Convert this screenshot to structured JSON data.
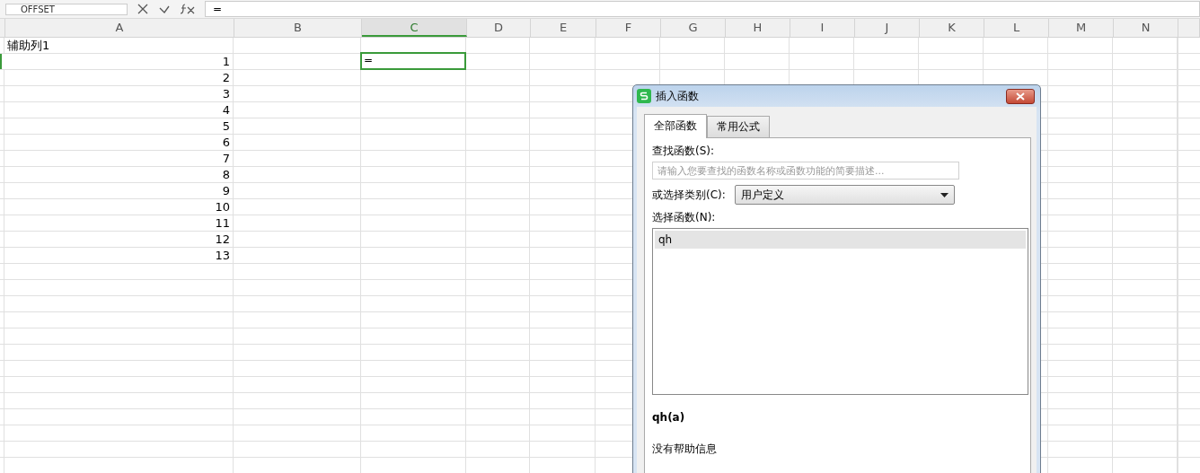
{
  "formula_bar": {
    "name_box": "OFFSET",
    "formula": "="
  },
  "columns": [
    {
      "label": "A",
      "selected": false
    },
    {
      "label": "B",
      "selected": false
    },
    {
      "label": "C",
      "selected": true
    },
    {
      "label": "D",
      "selected": false
    },
    {
      "label": "E",
      "selected": false
    },
    {
      "label": "F",
      "selected": false
    },
    {
      "label": "G",
      "selected": false
    },
    {
      "label": "H",
      "selected": false
    },
    {
      "label": "I",
      "selected": false
    },
    {
      "label": "J",
      "selected": false
    },
    {
      "label": "K",
      "selected": false
    },
    {
      "label": "L",
      "selected": false
    },
    {
      "label": "M",
      "selected": false
    },
    {
      "label": "N",
      "selected": false
    }
  ],
  "rows": [
    {
      "kind": "text",
      "a": "辅助列1",
      "selected": false
    },
    {
      "kind": "number",
      "a": "1",
      "c": "=",
      "selected": true
    },
    {
      "kind": "number",
      "a": "2",
      "selected": false
    },
    {
      "kind": "number",
      "a": "3",
      "selected": false
    },
    {
      "kind": "number",
      "a": "4",
      "selected": false
    },
    {
      "kind": "number",
      "a": "5",
      "selected": false
    },
    {
      "kind": "number",
      "a": "6",
      "selected": false
    },
    {
      "kind": "number",
      "a": "7",
      "selected": false
    },
    {
      "kind": "number",
      "a": "8",
      "selected": false
    },
    {
      "kind": "number",
      "a": "9",
      "selected": false
    },
    {
      "kind": "number",
      "a": "10",
      "selected": false
    },
    {
      "kind": "number",
      "a": "11",
      "selected": false
    },
    {
      "kind": "number",
      "a": "12",
      "selected": false
    },
    {
      "kind": "number",
      "a": "13",
      "selected": false
    }
  ],
  "dialog": {
    "title": "插入函数",
    "tabs": [
      {
        "label": "全部函数",
        "selected": true
      },
      {
        "label": "常用公式",
        "selected": false
      }
    ],
    "search_label": "查找函数(S):",
    "search_placeholder": "请输入您要查找的函数名称或函数功能的简要描述...",
    "category_label": "或选择类别(C):",
    "category_value": "用户定义",
    "list_label": "选择函数(N):",
    "functions": [
      {
        "label": "qh",
        "selected": true
      }
    ],
    "signature": "qh(a)",
    "help": "没有帮助信息"
  }
}
